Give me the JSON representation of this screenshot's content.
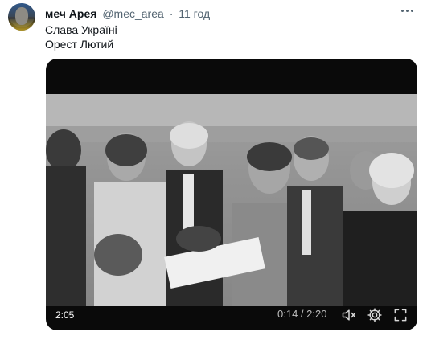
{
  "tweet": {
    "display_name": "меч Арея",
    "handle": "@mec_area",
    "separator": "·",
    "time": "11 год",
    "text_lines": [
      "Слава Україні",
      "Орест Лютий"
    ]
  },
  "video": {
    "duration_badge": "2:05",
    "current_time": "0:14",
    "time_separator": " / ",
    "total_time": "2:20",
    "controls": {
      "mute_icon": "speaker-muted-icon",
      "settings_icon": "gear-icon",
      "fullscreen_icon": "fullscreen-icon"
    }
  },
  "colors": {
    "primary_text": "#0f1419",
    "secondary_text": "#536471",
    "media_background": "#0a0a0a"
  }
}
